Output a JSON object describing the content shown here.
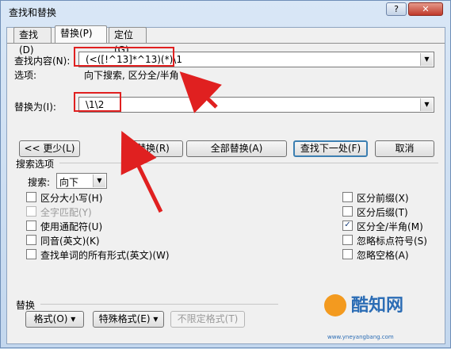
{
  "window": {
    "title": "查找和替换",
    "help": "?",
    "close": "✕"
  },
  "tabs": [
    {
      "label": "查找(D)"
    },
    {
      "label": "替换(P)"
    },
    {
      "label": "定位(G)"
    }
  ],
  "find": {
    "label": "查找内容(N):",
    "value": "(<([!^13]*^13)(*)\\1"
  },
  "options": {
    "label": "选项:",
    "value": "向下搜索, 区分全/半角"
  },
  "replace": {
    "label": "替换为(I):",
    "value": "\\1\\2"
  },
  "buttons": {
    "less": "<< 更少(L)",
    "replace": "替换(R)",
    "replace_all": "全部替换(A)",
    "find_next": "查找下一处(F)",
    "cancel": "取消"
  },
  "search_options": {
    "title": "搜索选项",
    "search_label": "搜索:",
    "search_value": "向下"
  },
  "left_checks": [
    {
      "label": "区分大小写(H)",
      "checked": false,
      "disabled": false
    },
    {
      "label": "全字匹配(Y)",
      "checked": false,
      "disabled": true
    },
    {
      "label": "使用通配符(U)",
      "checked": false,
      "disabled": false
    },
    {
      "label": "同音(英文)(K)",
      "checked": false,
      "disabled": false
    },
    {
      "label": "查找单词的所有形式(英文)(W)",
      "checked": false,
      "disabled": false
    }
  ],
  "right_checks": [
    {
      "label": "区分前缀(X)",
      "checked": false
    },
    {
      "label": "区分后缀(T)",
      "checked": false
    },
    {
      "label": "区分全/半角(M)",
      "checked": true
    },
    {
      "label": "忽略标点符号(S)",
      "checked": false
    },
    {
      "label": "忽略空格(A)",
      "checked": false
    }
  ],
  "replace_section": {
    "title": "替换",
    "format": "格式(O) ▾",
    "special": "特殊格式(E) ▾",
    "no_format": "不限定格式(T)"
  },
  "watermark": {
    "brand": "酷知网",
    "site": "www.yneyangbang.com"
  },
  "colors": {
    "annotation": "#e02020",
    "accent": "#3c7fb1"
  }
}
